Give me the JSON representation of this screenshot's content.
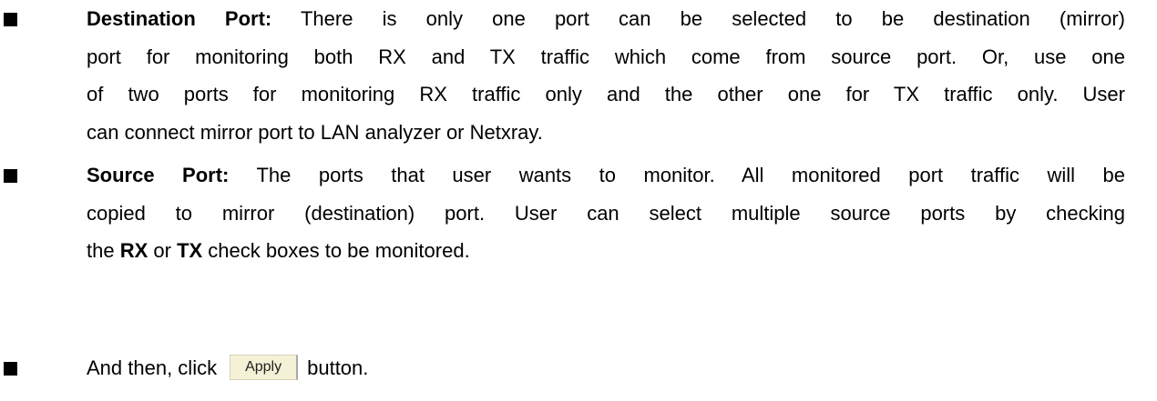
{
  "items": [
    {
      "term": "Destination Port:",
      "lines": [
        " There is only one port can be selected to be destination (mirror)",
        "port for monitoring both RX and TX traffic which come from source port. Or, use one",
        "of two ports for monitoring RX traffic only and the other one for TX traffic only. User",
        "can connect mirror port to LAN analyzer or Netxray."
      ]
    },
    {
      "term": "Source Port:",
      "lines": [
        " The ports that user wants to monitor. All monitored port traffic will be",
        "copied to mirror (destination) port. User can select multiple source ports by checking"
      ],
      "last_line": {
        "pre": "the ",
        "rx": "RX",
        "mid": " or ",
        "tx": "TX",
        "post": " check boxes to be monitored."
      }
    },
    {
      "pre": "And then, click",
      "button": "Apply",
      "post": "button."
    }
  ]
}
